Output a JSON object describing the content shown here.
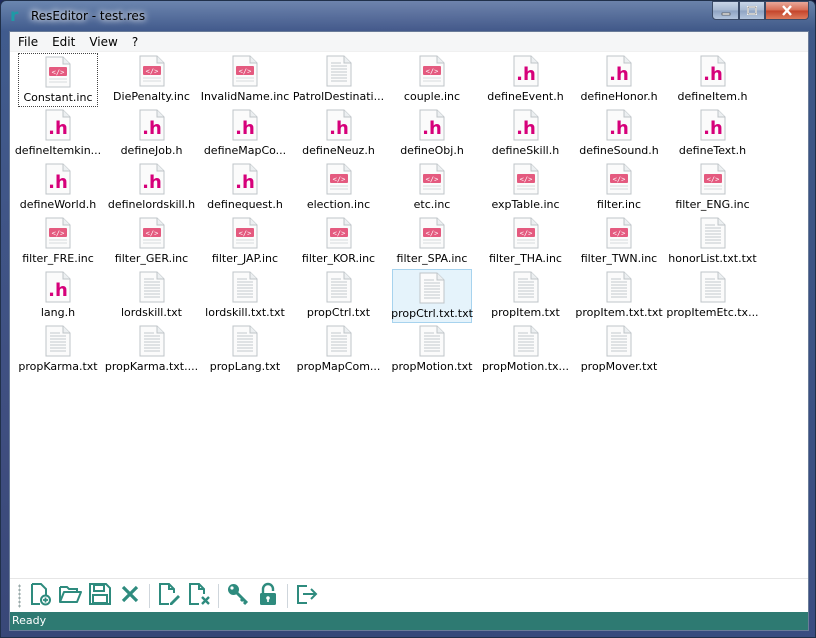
{
  "window": {
    "title": "ResEditor - test.res",
    "app_icon": "r"
  },
  "menu": [
    "File",
    "Edit",
    "View",
    "?"
  ],
  "files": [
    {
      "label": "Constant.inc",
      "type": "inc"
    },
    {
      "label": "DiePenalty.inc",
      "type": "inc"
    },
    {
      "label": "InvalidName.inc",
      "type": "inc"
    },
    {
      "label": "PatrolDestinati...",
      "type": "txt"
    },
    {
      "label": "couple.inc",
      "type": "inc"
    },
    {
      "label": "defineEvent.h",
      "type": "h"
    },
    {
      "label": "defineHonor.h",
      "type": "h"
    },
    {
      "label": "defineItem.h",
      "type": "h"
    },
    {
      "label": "defineItemkin...",
      "type": "h"
    },
    {
      "label": "defineJob.h",
      "type": "h"
    },
    {
      "label": "defineMapCo...",
      "type": "h"
    },
    {
      "label": "defineNeuz.h",
      "type": "h"
    },
    {
      "label": "defineObj.h",
      "type": "h"
    },
    {
      "label": "defineSkill.h",
      "type": "h"
    },
    {
      "label": "defineSound.h",
      "type": "h"
    },
    {
      "label": "defineText.h",
      "type": "h"
    },
    {
      "label": "defineWorld.h",
      "type": "h"
    },
    {
      "label": "definelordskill.h",
      "type": "h"
    },
    {
      "label": "definequest.h",
      "type": "h"
    },
    {
      "label": "election.inc",
      "type": "inc"
    },
    {
      "label": "etc.inc",
      "type": "inc"
    },
    {
      "label": "expTable.inc",
      "type": "inc"
    },
    {
      "label": "filter.inc",
      "type": "inc"
    },
    {
      "label": "filter_ENG.inc",
      "type": "inc"
    },
    {
      "label": "filter_FRE.inc",
      "type": "inc"
    },
    {
      "label": "filter_GER.inc",
      "type": "inc"
    },
    {
      "label": "filter_JAP.inc",
      "type": "inc"
    },
    {
      "label": "filter_KOR.inc",
      "type": "inc"
    },
    {
      "label": "filter_SPA.inc",
      "type": "inc"
    },
    {
      "label": "filter_THA.inc",
      "type": "inc"
    },
    {
      "label": "filter_TWN.inc",
      "type": "inc"
    },
    {
      "label": "honorList.txt.txt",
      "type": "txt"
    },
    {
      "label": "lang.h",
      "type": "h"
    },
    {
      "label": "lordskill.txt",
      "type": "txt"
    },
    {
      "label": "lordskill.txt.txt",
      "type": "txt"
    },
    {
      "label": "propCtrl.txt",
      "type": "txt"
    },
    {
      "label": "propCtrl.txt.txt",
      "type": "txt"
    },
    {
      "label": "propItem.txt",
      "type": "txt"
    },
    {
      "label": "propItem.txt.txt",
      "type": "txt"
    },
    {
      "label": "propItemEtc.tx...",
      "type": "txt"
    },
    {
      "label": "propKarma.txt",
      "type": "txt"
    },
    {
      "label": "propKarma.txt....",
      "type": "txt"
    },
    {
      "label": "propLang.txt",
      "type": "txt"
    },
    {
      "label": "propMapCom...",
      "type": "txt"
    },
    {
      "label": "propMotion.txt",
      "type": "txt"
    },
    {
      "label": "propMotion.tx...",
      "type": "txt"
    },
    {
      "label": "propMover.txt",
      "type": "txt"
    }
  ],
  "focused_index": 0,
  "selected_index": 36,
  "toolbar": [
    {
      "name": "new-file-icon"
    },
    {
      "name": "open-folder-icon"
    },
    {
      "name": "save-icon"
    },
    {
      "name": "close-icon"
    },
    {
      "sep": true
    },
    {
      "name": "edit-file-icon"
    },
    {
      "name": "delete-file-icon"
    },
    {
      "sep": true
    },
    {
      "name": "key-icon"
    },
    {
      "name": "lock-icon"
    },
    {
      "sep": true
    },
    {
      "name": "exit-icon"
    }
  ],
  "status": "Ready",
  "colors": {
    "accent": "#2e8b7e",
    "status_bar": "#2e7a72",
    "h_glyph": "#d6007a",
    "inc_tag": "#e0507a"
  }
}
